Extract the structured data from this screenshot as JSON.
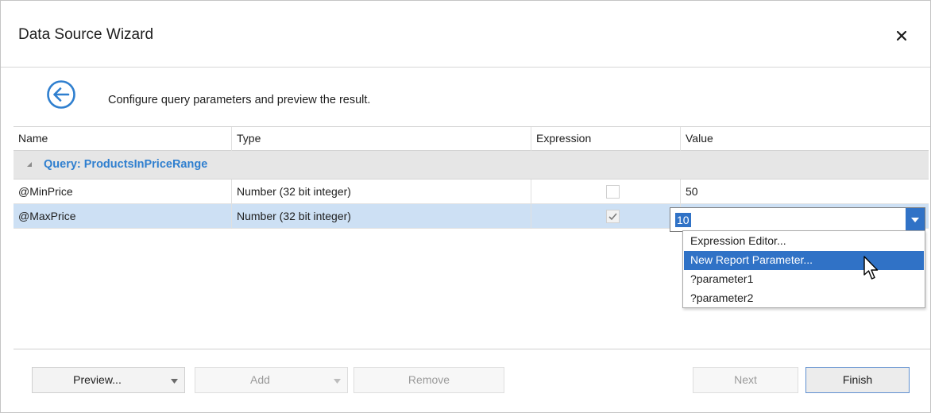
{
  "window": {
    "title": "Data Source Wizard"
  },
  "header": {
    "description": "Configure query parameters and preview the result."
  },
  "grid": {
    "columns": [
      "Name",
      "Type",
      "Expression",
      "Value"
    ],
    "group": {
      "label": "Query: ProductsInPriceRange"
    },
    "rows": [
      {
        "name": "@MinPrice",
        "type": "Number (32 bit integer)",
        "expression": false,
        "value": "50"
      },
      {
        "name": "@MaxPrice",
        "type": "Number (32 bit integer)",
        "expression": true,
        "value": "10"
      }
    ]
  },
  "editor": {
    "value": "10",
    "options": [
      "Expression Editor...",
      "New Report Parameter...",
      "?parameter1",
      "?parameter2"
    ],
    "highlighted_option": "New Report Parameter..."
  },
  "footer": {
    "preview_label": "Preview...",
    "add_label": "Add",
    "remove_label": "Remove",
    "next_label": "Next",
    "finish_label": "Finish"
  },
  "icons": {
    "back": "back-arrow-circle-icon",
    "close": "close-icon",
    "group_toggle": "collapse-triangle-icon",
    "check": "checkmark-icon",
    "dropdown": "chevron-down-icon",
    "cursor": "mouse-pointer-icon"
  },
  "colors": {
    "accent": "#3072c6",
    "group_label": "#2f7fcf",
    "selected_row": "#cde0f4",
    "group_background": "#e6e6e6"
  }
}
